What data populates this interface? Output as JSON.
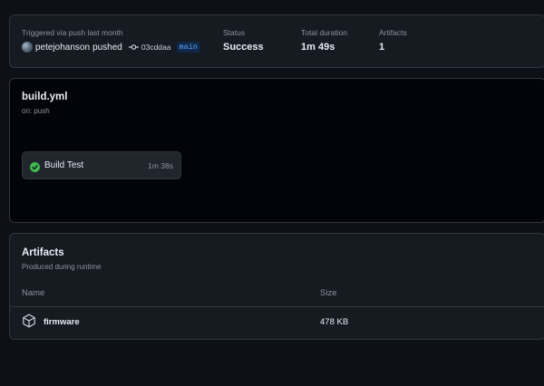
{
  "summary": {
    "trigger_text": "Triggered via push last month",
    "actor": "petejohanson",
    "action": "pushed",
    "commit_sha": "03cddaa",
    "branch": "main",
    "status_label": "Status",
    "status_value": "Success",
    "duration_label": "Total duration",
    "duration_value": "1m 49s",
    "artifacts_label": "Artifacts",
    "artifacts_value": "1"
  },
  "workflow": {
    "file": "build.yml",
    "trigger": "on: push",
    "jobs": [
      {
        "name": "Build Test",
        "duration": "1m 38s",
        "status": "success"
      }
    ]
  },
  "artifacts": {
    "title": "Artifacts",
    "subtitle": "Produced during runtime",
    "columns": {
      "name": "Name",
      "size": "Size"
    },
    "rows": [
      {
        "name": "firmware",
        "size": "478 KB"
      }
    ]
  },
  "colors": {
    "background": "#0d1117",
    "success": "#3fb950",
    "link": "#58a6ff"
  }
}
